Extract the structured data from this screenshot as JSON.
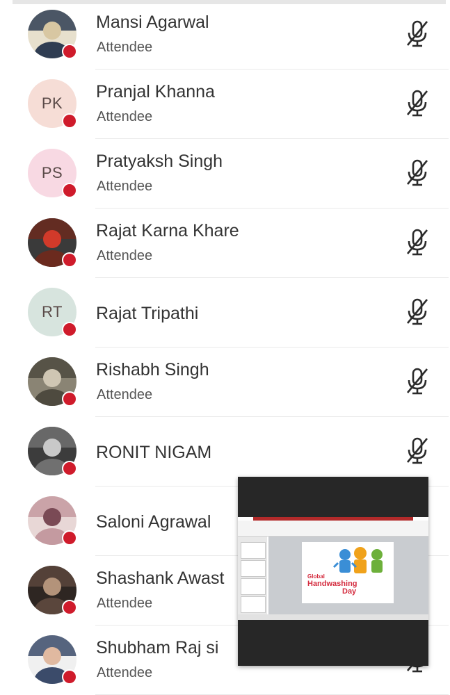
{
  "participants": [
    {
      "name": "Mansi Agarwal",
      "role": "Attendee",
      "avatar": {
        "type": "photo",
        "colors": [
          "#2f3d52",
          "#d8c7a2",
          "#e7e0cd"
        ]
      }
    },
    {
      "name": "Pranjal Khanna",
      "role": "Attendee",
      "avatar": {
        "type": "initials",
        "initials": "PK",
        "bg": "#f6ddd6"
      }
    },
    {
      "name": "Pratyaksh Singh",
      "role": "Attendee",
      "avatar": {
        "type": "initials",
        "initials": "PS",
        "bg": "#f8d9e3"
      }
    },
    {
      "name": "Rajat Karna Khare",
      "role": "Attendee",
      "avatar": {
        "type": "photo",
        "colors": [
          "#6b2a1e",
          "#d13a2a",
          "#3a3a3a"
        ]
      }
    },
    {
      "name": "Rajat Tripathi",
      "role": "",
      "avatar": {
        "type": "initials",
        "initials": "RT",
        "bg": "#d7e4de"
      }
    },
    {
      "name": "Rishabh Singh",
      "role": "Attendee",
      "avatar": {
        "type": "photo",
        "colors": [
          "#4e4a3f",
          "#cfc6b3",
          "#8a8474"
        ]
      }
    },
    {
      "name": "RONIT NIGAM",
      "role": "",
      "avatar": {
        "type": "photo",
        "colors": [
          "#707070",
          "#c9c9c9",
          "#3c3c3c"
        ]
      }
    },
    {
      "name": "Saloni Agrawal",
      "role": "",
      "avatar": {
        "type": "photo",
        "colors": [
          "#c49aa0",
          "#7a4a55",
          "#e8d7d6"
        ]
      }
    },
    {
      "name": "Shashank Awast",
      "role": "Attendee",
      "avatar": {
        "type": "photo",
        "colors": [
          "#5a463c",
          "#b3937a",
          "#2e2622"
        ]
      }
    },
    {
      "name": "Shubham Raj si",
      "role": "Attendee",
      "avatar": {
        "type": "photo",
        "colors": [
          "#3b4b6a",
          "#e0b9a0",
          "#f0f0f0"
        ]
      }
    }
  ],
  "mic_icon": "microphone-muted-icon",
  "status_dot_color": "#cf1b2b",
  "pip": {
    "slide_title_line1": "Global",
    "slide_title_line2": "Handwashing",
    "slide_title_line3": "Day"
  }
}
